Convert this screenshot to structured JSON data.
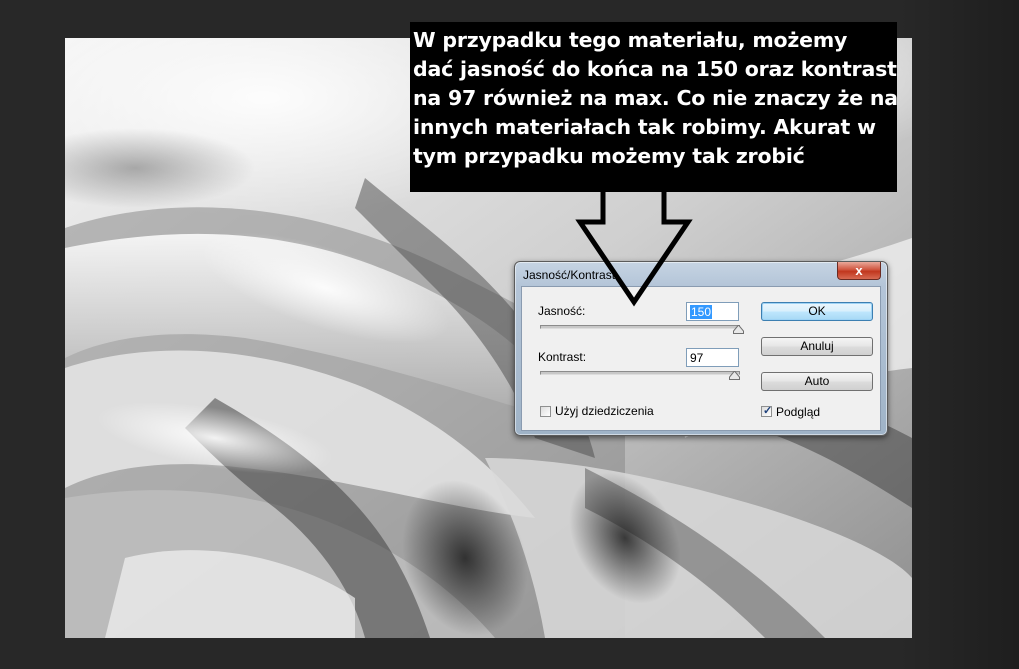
{
  "annotation": {
    "lines": [
      "W przypadku tego materiału, możemy",
      "dać jasność do końca na 150 oraz kontrast",
      "na 97 również na max. Co nie znaczy że na",
      "innych materiałach tak robimy. Akurat w",
      "tym przypadku możemy tak zrobić"
    ]
  },
  "dialog": {
    "title": "Jasność/Kontrast",
    "close_label": "x",
    "brightness": {
      "label": "Jasność:",
      "value": "150",
      "slider_fraction": 1.0
    },
    "contrast": {
      "label": "Kontrast:",
      "value": "97",
      "slider_fraction": 0.97
    },
    "legacy": {
      "label": "Użyj dziedziczenia",
      "checked": false
    },
    "preview": {
      "label": "Podgląd",
      "checked": true
    },
    "buttons": {
      "ok": "OK",
      "cancel": "Anuluj",
      "auto": "Auto"
    }
  }
}
